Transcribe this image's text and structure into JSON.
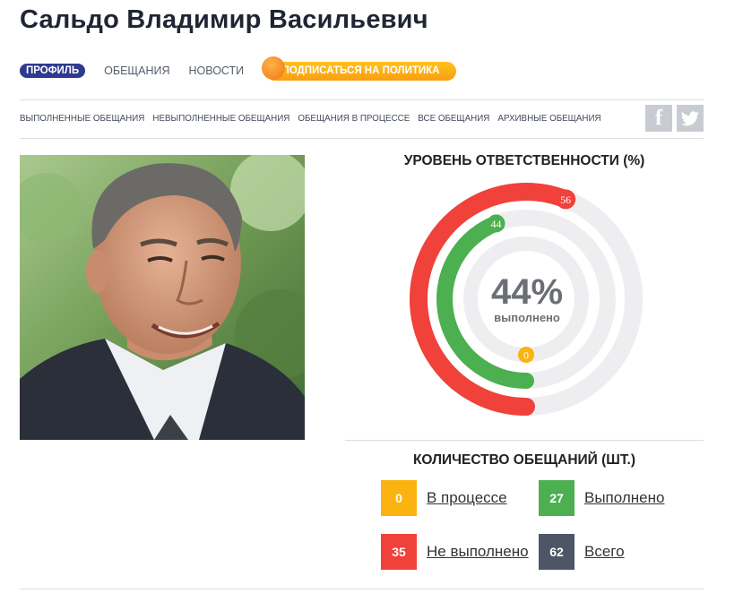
{
  "title": "Сальдо Владимир Васильевич",
  "tabs": [
    {
      "label": "ПРОФИЛЬ"
    },
    {
      "label": "ОБЕЩАНИЯ"
    },
    {
      "label": "НОВОСТИ"
    }
  ],
  "subscribe_label": "ПОДПИСАТЬСЯ НА ПОЛИТИКА",
  "filters": [
    {
      "label": "ВЫПОЛНЕННЫЕ ОБЕЩАНИЯ"
    },
    {
      "label": "НЕВЫПОЛНЕННЫЕ ОБЕЩАНИЯ"
    },
    {
      "label": "ОБЕЩАНИЯ В ПРОЦЕССЕ"
    },
    {
      "label": "ВСЕ ОБЕЩАНИЯ"
    },
    {
      "label": "АРХИВНЫЕ ОБЕЩАНИЯ"
    }
  ],
  "social": {
    "facebook_glyph": "f",
    "twitter_icon": "twitter-icon"
  },
  "responsibility": {
    "title": "УРОВЕНЬ ОТВЕТСТВЕННОСТИ (%)",
    "percent": "44%",
    "percent_label": "выполнено",
    "rings": [
      {
        "label": "56",
        "value": 56,
        "color": "#f0413b"
      },
      {
        "label": "44",
        "value": 44,
        "color": "#4caf50"
      },
      {
        "label": "0",
        "value": 0,
        "color": "#fbb30f"
      }
    ]
  },
  "counts": {
    "title": "КОЛИЧЕСТВО ОБЕЩАНИЙ (ШТ.)",
    "items": [
      {
        "value": "0",
        "label": "В процессе",
        "color": "#fbb30f"
      },
      {
        "value": "27",
        "label": "Выполнено",
        "color": "#4caf50"
      },
      {
        "value": "35",
        "label": "Не выполнено",
        "color": "#f0413b"
      },
      {
        "value": "62",
        "label": "Всего",
        "color": "#4e5566"
      }
    ]
  }
}
